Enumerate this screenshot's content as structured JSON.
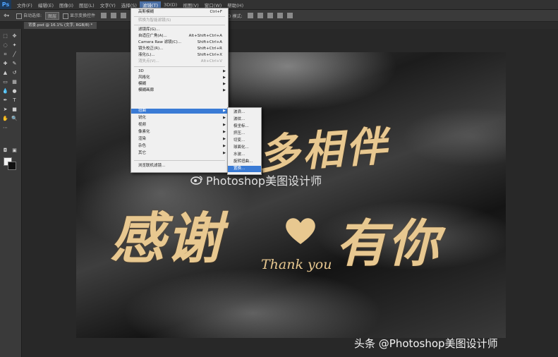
{
  "app": {
    "logo": "Ps"
  },
  "menubar": {
    "items": [
      "文件(F)",
      "编辑(E)",
      "图像(I)",
      "图层(L)",
      "文字(Y)",
      "选择(S)",
      "滤镜(T)",
      "3D(D)",
      "视图(V)",
      "窗口(W)",
      "帮助(H)"
    ],
    "active_index": 6
  },
  "optbar": {
    "auto_select_label": "自动选择:",
    "auto_select_value": "图层",
    "show_transform_label": "显示变换控件",
    "mode_3d_label": "3D 模式:"
  },
  "document": {
    "tab_title": "背景.psd @ 16.1% (文字, RGB/8) *"
  },
  "filter_menu": {
    "items": [
      {
        "label": "高斯模糊",
        "shortcut": "Ctrl+F",
        "disabled": false,
        "submenu": false
      },
      {
        "label": "转换为智能滤镜(S)",
        "shortcut": "",
        "disabled": true,
        "submenu": false
      },
      {
        "label": "滤镜库(G)...",
        "shortcut": "",
        "disabled": false,
        "submenu": false
      },
      {
        "label": "自适应广角(A)...",
        "shortcut": "Alt+Shift+Ctrl+A",
        "disabled": false,
        "submenu": false
      },
      {
        "label": "Camera Raw 滤镜(C)...",
        "shortcut": "Shift+Ctrl+A",
        "disabled": false,
        "submenu": false
      },
      {
        "label": "镜头校正(R)...",
        "shortcut": "Shift+Ctrl+R",
        "disabled": false,
        "submenu": false
      },
      {
        "label": "液化(L)...",
        "shortcut": "Shift+Ctrl+X",
        "disabled": false,
        "submenu": false
      },
      {
        "label": "消失点(V)...",
        "shortcut": "Alt+Ctrl+V",
        "disabled": true,
        "submenu": false
      },
      {
        "label": "3D",
        "shortcut": "",
        "disabled": false,
        "submenu": true
      },
      {
        "label": "风格化",
        "shortcut": "",
        "disabled": false,
        "submenu": true
      },
      {
        "label": "模糊",
        "shortcut": "",
        "disabled": false,
        "submenu": true
      },
      {
        "label": "模糊画廊",
        "shortcut": "",
        "disabled": false,
        "submenu": true
      },
      {
        "label": "扭曲",
        "shortcut": "",
        "disabled": false,
        "submenu": true,
        "highlighted": true
      },
      {
        "label": "锐化",
        "shortcut": "",
        "disabled": false,
        "submenu": true
      },
      {
        "label": "视频",
        "shortcut": "",
        "disabled": false,
        "submenu": true
      },
      {
        "label": "像素化",
        "shortcut": "",
        "disabled": false,
        "submenu": true
      },
      {
        "label": "渲染",
        "shortcut": "",
        "disabled": false,
        "submenu": true
      },
      {
        "label": "杂色",
        "shortcut": "",
        "disabled": false,
        "submenu": true
      },
      {
        "label": "其它",
        "shortcut": "",
        "disabled": false,
        "submenu": true
      },
      {
        "label": "浏览联机滤镜...",
        "shortcut": "",
        "disabled": false,
        "submenu": false
      }
    ]
  },
  "distort_submenu": {
    "items": [
      "波浪...",
      "波纹...",
      "极坐标...",
      "挤压...",
      "切变...",
      "球面化...",
      "水波...",
      "旋转扭曲...",
      "置换..."
    ],
    "highlighted_index": 8
  },
  "canvas": {
    "line1": "多相伴",
    "line2": "感谢",
    "line3": "有你",
    "thank_you": "Thank you"
  },
  "watermarks": {
    "center": "Photoshop美图设计师",
    "bottom": "头条 @Photoshop美图设计师"
  },
  "colors": {
    "gold": "#e8c890",
    "menu_highlight": "#3a7bd5",
    "ps_blue": "#4fa3ff"
  }
}
